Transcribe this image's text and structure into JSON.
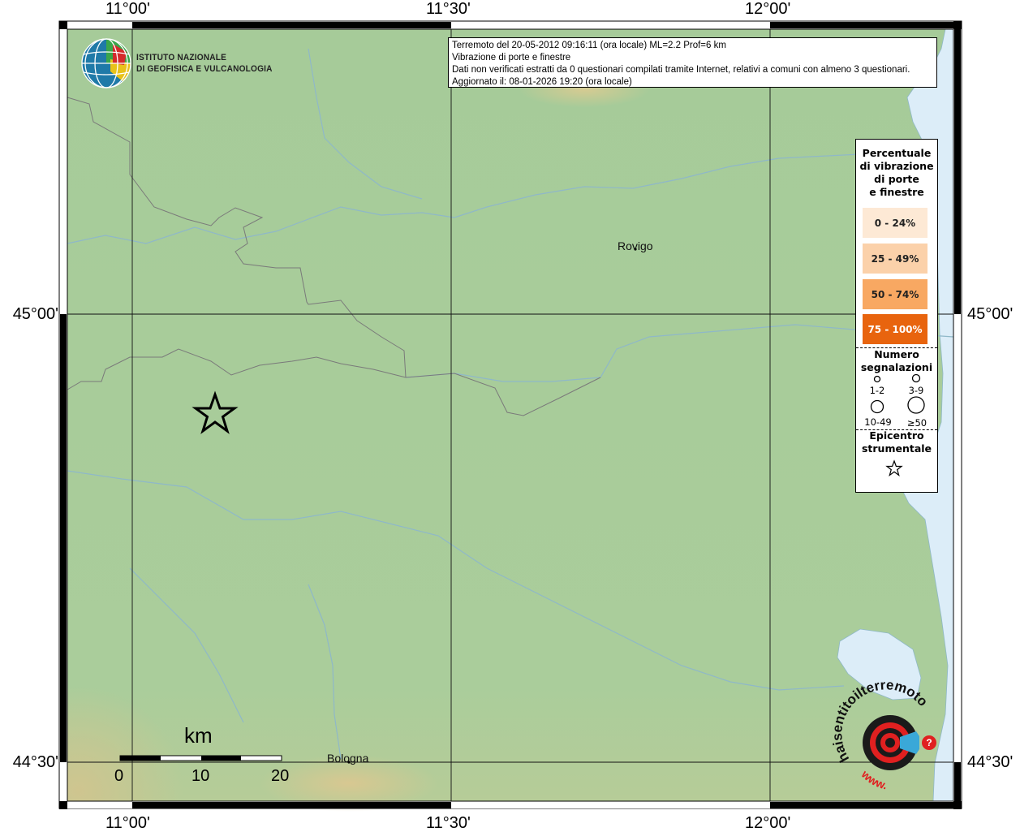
{
  "axes": {
    "lon_labels": [
      "11°00'",
      "11°30'",
      "12°00'"
    ],
    "lat_labels": [
      "45°00'",
      "44°30'"
    ]
  },
  "info": {
    "line1": "Terremoto del 20-05-2012 09:16:11 (ora locale) ML=2.2 Prof=6 km",
    "line2": "Vibrazione di porte e finestre",
    "line3": "Dati non verificati estratti da 0 questionari compilati tramite Internet, relativi a comuni con almeno 3 questionari.",
    "line4": "Aggiornato il: 08-01-2026 19:20 (ora locale)"
  },
  "logo": {
    "line1": "ISTITUTO NAZIONALE",
    "line2": "DI GEOFISICA E VULCANOLOGIA"
  },
  "legend": {
    "title_lines": [
      "Percentuale",
      "di vibrazione",
      "di porte",
      "e finestre"
    ],
    "classes": [
      {
        "label": "0 - 24%",
        "color": "#fde9d5"
      },
      {
        "label": "25 - 49%",
        "color": "#fbd1aa"
      },
      {
        "label": "50 - 74%",
        "color": "#f8a862"
      },
      {
        "label": "75 - 100%",
        "color": "#e8640e"
      }
    ],
    "count_title_lines": [
      "Numero",
      "segnalazioni"
    ],
    "count_labels": [
      "1-2",
      "3-9",
      "10-49",
      "≥50"
    ],
    "epicenter_title_lines": [
      "Epicentro",
      "strumentale"
    ]
  },
  "cities": {
    "rovigo": "Rovigo",
    "bologna": "Bologna"
  },
  "scalebar": {
    "unit": "km",
    "ticks": [
      "0",
      "10",
      "20"
    ]
  },
  "watermark": {
    "text": "haisentitoilterremoto.it",
    "prefix": "www."
  },
  "colors": {
    "plain": "#a9cc9a",
    "hills": "#c9c796",
    "sea": "#dcedf8",
    "river": "#8fb8c8",
    "border": "#777777"
  }
}
